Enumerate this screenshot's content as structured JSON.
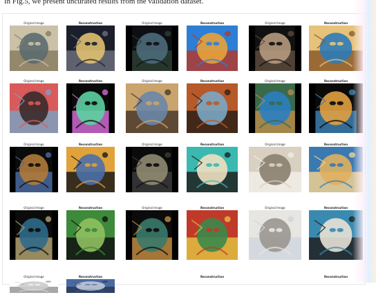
{
  "caption": "In Fig.5, we present uncurated results from the validation dataset.",
  "labels": {
    "original": "Original Image",
    "reconstruction": "Reconstruction"
  },
  "figure": {
    "rows": [
      {
        "pairs": [
          {
            "original": {
              "theme": "desert-horizon",
              "colors": [
                "#c9c2a8",
                "#5d6a6e",
                "#8a7d62"
              ]
            },
            "reconstruction": {
              "theme": "dark-landscape-sun",
              "colors": [
                "#1a1f2b",
                "#e0c070",
                "#6a6e7a"
              ]
            }
          },
          {
            "original": {
              "theme": "tree-dark",
              "colors": [
                "#0d0f12",
                "#4d6a7a",
                "#2b3d33"
              ]
            },
            "reconstruction": {
              "theme": "ship-sea",
              "colors": [
                "#2d7fd6",
                "#e8a23a",
                "#b03a2e"
              ]
            }
          },
          {
            "original": {
              "theme": "dark-portrait",
              "colors": [
                "#111",
                "#b59a7e",
                "#5a4a3c"
              ]
            },
            "reconstruction": {
              "theme": "gold-face",
              "colors": [
                "#e6c27a",
                "#2e7bb8",
                "#8c5a2a"
              ]
            }
          }
        ]
      },
      {
        "pairs": [
          {
            "original": {
              "theme": "coral-woman",
              "colors": [
                "#d85a5a",
                "#3a2a2a",
                "#7fa0c0"
              ]
            },
            "reconstruction": {
              "theme": "bird-creature",
              "colors": [
                "#0a0a0a",
                "#5bd1a0",
                "#d06ad4"
              ]
            }
          },
          {
            "original": {
              "theme": "mushroom-desert",
              "colors": [
                "#c9a46d",
                "#6a86a8",
                "#4b3a2a"
              ]
            },
            "reconstruction": {
              "theme": "mushroom-trees",
              "colors": [
                "#b65a2a",
                "#7ba6c4",
                "#2e2016"
              ]
            }
          },
          {
            "original": {
              "theme": "forest-tall",
              "colors": [
                "#3a6a4a",
                "#2b7fc2",
                "#b78a4a"
              ]
            },
            "reconstruction": {
              "theme": "tree-branches",
              "colors": [
                "#0a0a0a",
                "#e0a040",
                "#3b7fb0"
              ]
            }
          }
        ]
      },
      {
        "pairs": [
          {
            "original": {
              "theme": "masked-figure",
              "colors": [
                "#0b0b0b",
                "#b07a3a",
                "#4a6aa0"
              ]
            },
            "reconstruction": {
              "theme": "cubist-face",
              "colors": [
                "#e0a23a",
                "#4b6fa8",
                "#1a1a1a"
              ]
            }
          },
          {
            "original": {
              "theme": "owl-face",
              "colors": [
                "#0b0b0b",
                "#8f8a70",
                "#3a3a3a"
              ]
            },
            "reconstruction": {
              "theme": "alien-face",
              "colors": [
                "#3bb8b0",
                "#f0e0c0",
                "#202020"
              ]
            }
          },
          {
            "original": {
              "theme": "robot-head",
              "colors": [
                "#d8d0c0",
                "#8a8070",
                "#f2eee6"
              ]
            },
            "reconstruction": {
              "theme": "golden-android",
              "colors": [
                "#3a7ab0",
                "#e0b060",
                "#f0d090"
              ]
            }
          }
        ]
      },
      {
        "pairs": [
          {
            "original": {
              "theme": "tree-dusk",
              "colors": [
                "#0b0b0b",
                "#2e6a8a",
                "#b0a070"
              ]
            },
            "reconstruction": {
              "theme": "green-basket",
              "colors": [
                "#3d8a3a",
                "#90c060",
                "#101010"
              ]
            }
          },
          {
            "original": {
              "theme": "landscape-stream",
              "colors": [
                "#0b0b0b",
                "#3a7a6a",
                "#c08a40"
              ]
            },
            "reconstruction": {
              "theme": "colorful-field",
              "colors": [
                "#c03a2a",
                "#3a8a4a",
                "#e0c040"
              ]
            }
          },
          {
            "original": {
              "theme": "marble-woman",
              "colors": [
                "#e8e6e2",
                "#9a9690",
                "#d0d6de"
              ]
            },
            "reconstruction": {
              "theme": "melting-head",
              "colors": [
                "#3a8ab0",
                "#e8e2d6",
                "#202020"
              ]
            }
          }
        ]
      },
      {
        "pairs": [
          {
            "original": {
              "theme": "partial",
              "colors": [
                "#ffffff",
                "#cccccc",
                "#999999"
              ]
            },
            "reconstruction": {
              "theme": "partial-sky",
              "colors": [
                "#4a6aa0",
                "#c0c8d8",
                "#2a3a5a"
              ]
            }
          },
          {
            "original": {
              "theme": "blank",
              "colors": [
                "#ffffff",
                "#ffffff",
                "#ffffff"
              ]
            },
            "reconstruction": {
              "theme": "blank",
              "colors": [
                "#ffffff",
                "#ffffff",
                "#ffffff"
              ]
            }
          },
          {
            "original": {
              "theme": "blank",
              "colors": [
                "#ffffff",
                "#ffffff",
                "#ffffff"
              ]
            },
            "reconstruction": {
              "theme": "blank",
              "colors": [
                "#ffffff",
                "#ffffff",
                "#ffffff"
              ]
            }
          }
        ]
      }
    ]
  }
}
